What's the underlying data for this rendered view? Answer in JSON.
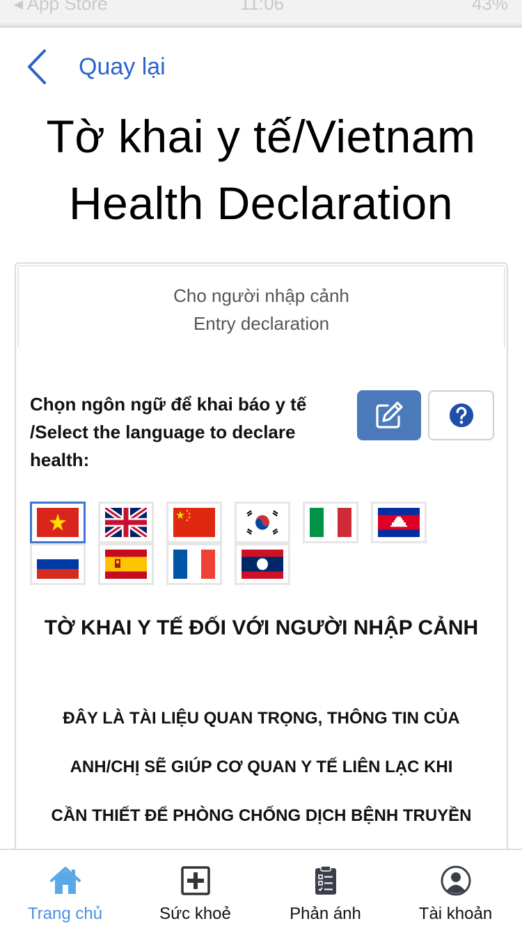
{
  "status_bar": {
    "left": "◂ App Store",
    "time": "11:06",
    "battery": "43%"
  },
  "nav": {
    "back_label": "Quay lại"
  },
  "title": {
    "line1": "Tờ khai y tế/Vietnam",
    "line2": "Health Declaration"
  },
  "tab_header": {
    "line1": "Cho người nhập cảnh",
    "line2": "Entry declaration"
  },
  "language": {
    "label": "Chọn ngôn ngữ để khai báo y tế /Select the language to declare health:",
    "flags": [
      "vietnam",
      "united-kingdom",
      "china",
      "south-korea",
      "italy",
      "cambodia",
      "russia",
      "spain",
      "france",
      "laos"
    ],
    "selected": "vietnam"
  },
  "declaration": {
    "title": "TỜ KHAI Y TẾ ĐỐI VỚI NGƯỜI NHẬP CẢNH",
    "line1": "ĐÂY LÀ TÀI LIỆU QUAN TRỌNG, THÔNG TIN CỦA",
    "line2": "ANH/CHỊ SẼ GIÚP CƠ QUAN Y TẾ LIÊN LẠC KHI",
    "line3": "CẦN THIẾT ĐỂ PHÒNG CHỐNG DỊCH BỆNH TRUYỀN"
  },
  "tabbar": {
    "items": [
      {
        "label": "Trang chủ",
        "icon": "home-icon",
        "active": true
      },
      {
        "label": "Sức khoẻ",
        "icon": "medical-cross-icon",
        "active": false
      },
      {
        "label": "Phản ánh",
        "icon": "clipboard-icon",
        "active": false
      },
      {
        "label": "Tài khoản",
        "icon": "account-icon",
        "active": false
      }
    ]
  },
  "colors": {
    "accent": "#2a64c8",
    "edit_button": "#4a7ab9",
    "tab_active": "#4a90e2"
  }
}
